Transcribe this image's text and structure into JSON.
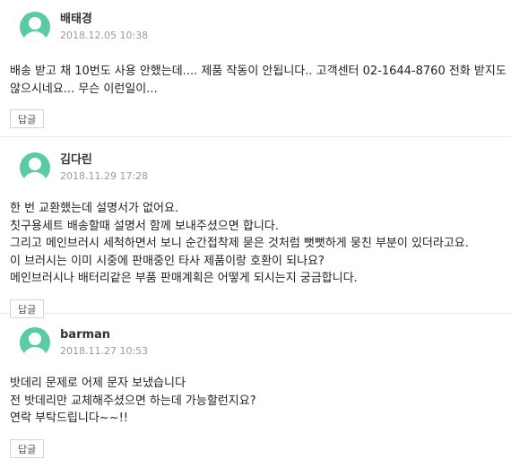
{
  "colors": {
    "avatar_bg": "#5ccaa3",
    "meta_text": "#9a9a9a",
    "border": "#e8e8e8"
  },
  "comments": [
    {
      "author": "배태경",
      "date": "2018.12.05 10:38",
      "lines": [
        "배송 받고 채 10번도 사용 안했는데.... 제품 작동이 안됩니다.. 고객센터 02-1644-8760 전화 받지도",
        "않으시네요... 무슨 이런일이..."
      ],
      "reply_label": "답글",
      "avatar_icon": "user-avatar-icon"
    },
    {
      "author": "김다린",
      "date": "2018.11.29 17:28",
      "lines": [
        "한 번 교환했는데 설명서가 없어요.",
        "칫구용세트 배송할때 설명서 함께 보내주셨으면 합니다.",
        "그리고 메인브러시 세척하면서 보니 순간접착제 묻은 것처럼 뻣뻣하게 뭉친 부분이 있더라고요.",
        "이 브러시는 이미 시중에 판매중인 타사 제품이랑 호환이 되나요?",
        "메인브러시나 배터리같은 부품 판매계획은 어떻게 되시는지 궁금합니다."
      ],
      "reply_label": "답글",
      "avatar_icon": "user-avatar-icon"
    },
    {
      "author": "barman",
      "date": "2018.11.27 10:53",
      "lines": [
        "밧데리 문제로 어제 문자 보냈습니다",
        "전 밧데리만 교체해주셨으면 하는데 가능할런지요?",
        "연락 부탁드립니다~~!!"
      ],
      "reply_label": "답글",
      "avatar_icon": "user-avatar-icon"
    }
  ]
}
